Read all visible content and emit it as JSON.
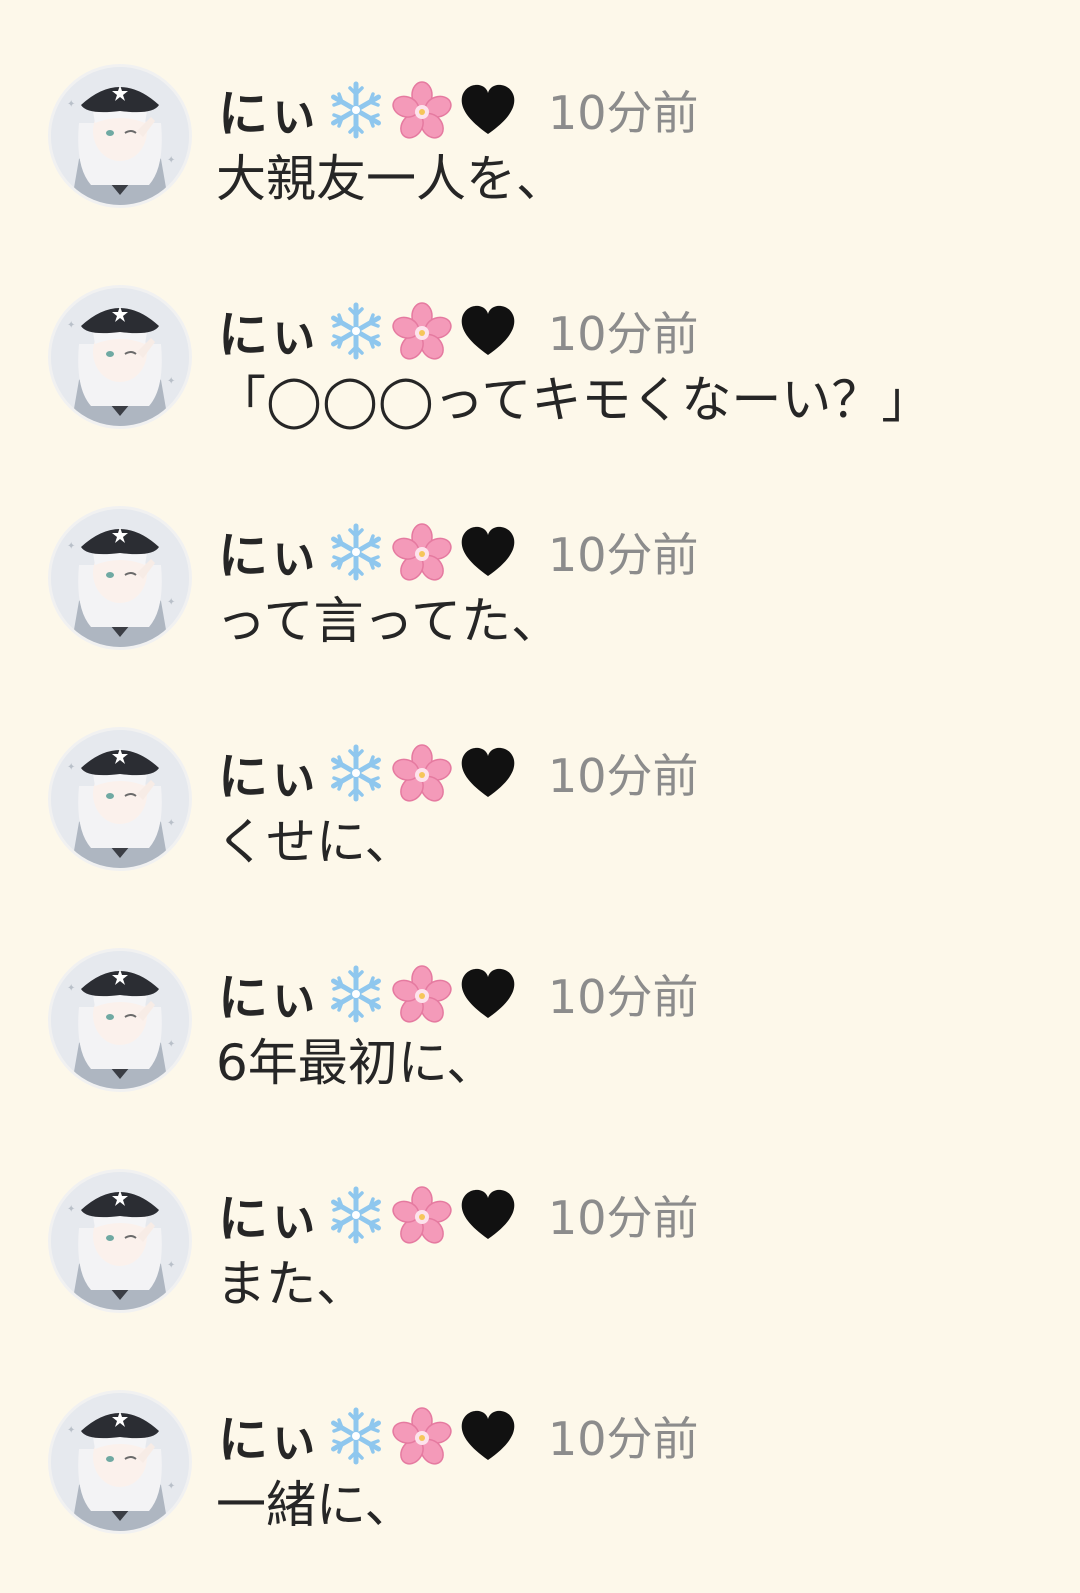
{
  "posts": [
    {
      "username": "にぃ",
      "time": "10分前",
      "message": "大親友一人を、"
    },
    {
      "username": "にぃ",
      "time": "10分前",
      "message": "「◯◯◯ってキモくなーい？」"
    },
    {
      "username": "にぃ",
      "time": "10分前",
      "message": "って言ってた、"
    },
    {
      "username": "にぃ",
      "time": "10分前",
      "message": "くせに、"
    },
    {
      "username": "にぃ",
      "time": "10分前",
      "message": "6年最初に、"
    },
    {
      "username": "にぃ",
      "time": "10分前",
      "message": "また、"
    },
    {
      "username": "にぃ",
      "time": "10分前",
      "message": "一緒に、"
    }
  ],
  "name_emojis": [
    "snowflake-icon",
    "cherry-blossom-icon",
    "black-heart-icon"
  ],
  "colors": {
    "background": "#fdf8ea",
    "text": "#262626",
    "timestamp": "#8c8c8c",
    "snowflake": "#8fc7ee",
    "blossom": "#f49ab9",
    "heart": "#111111"
  }
}
